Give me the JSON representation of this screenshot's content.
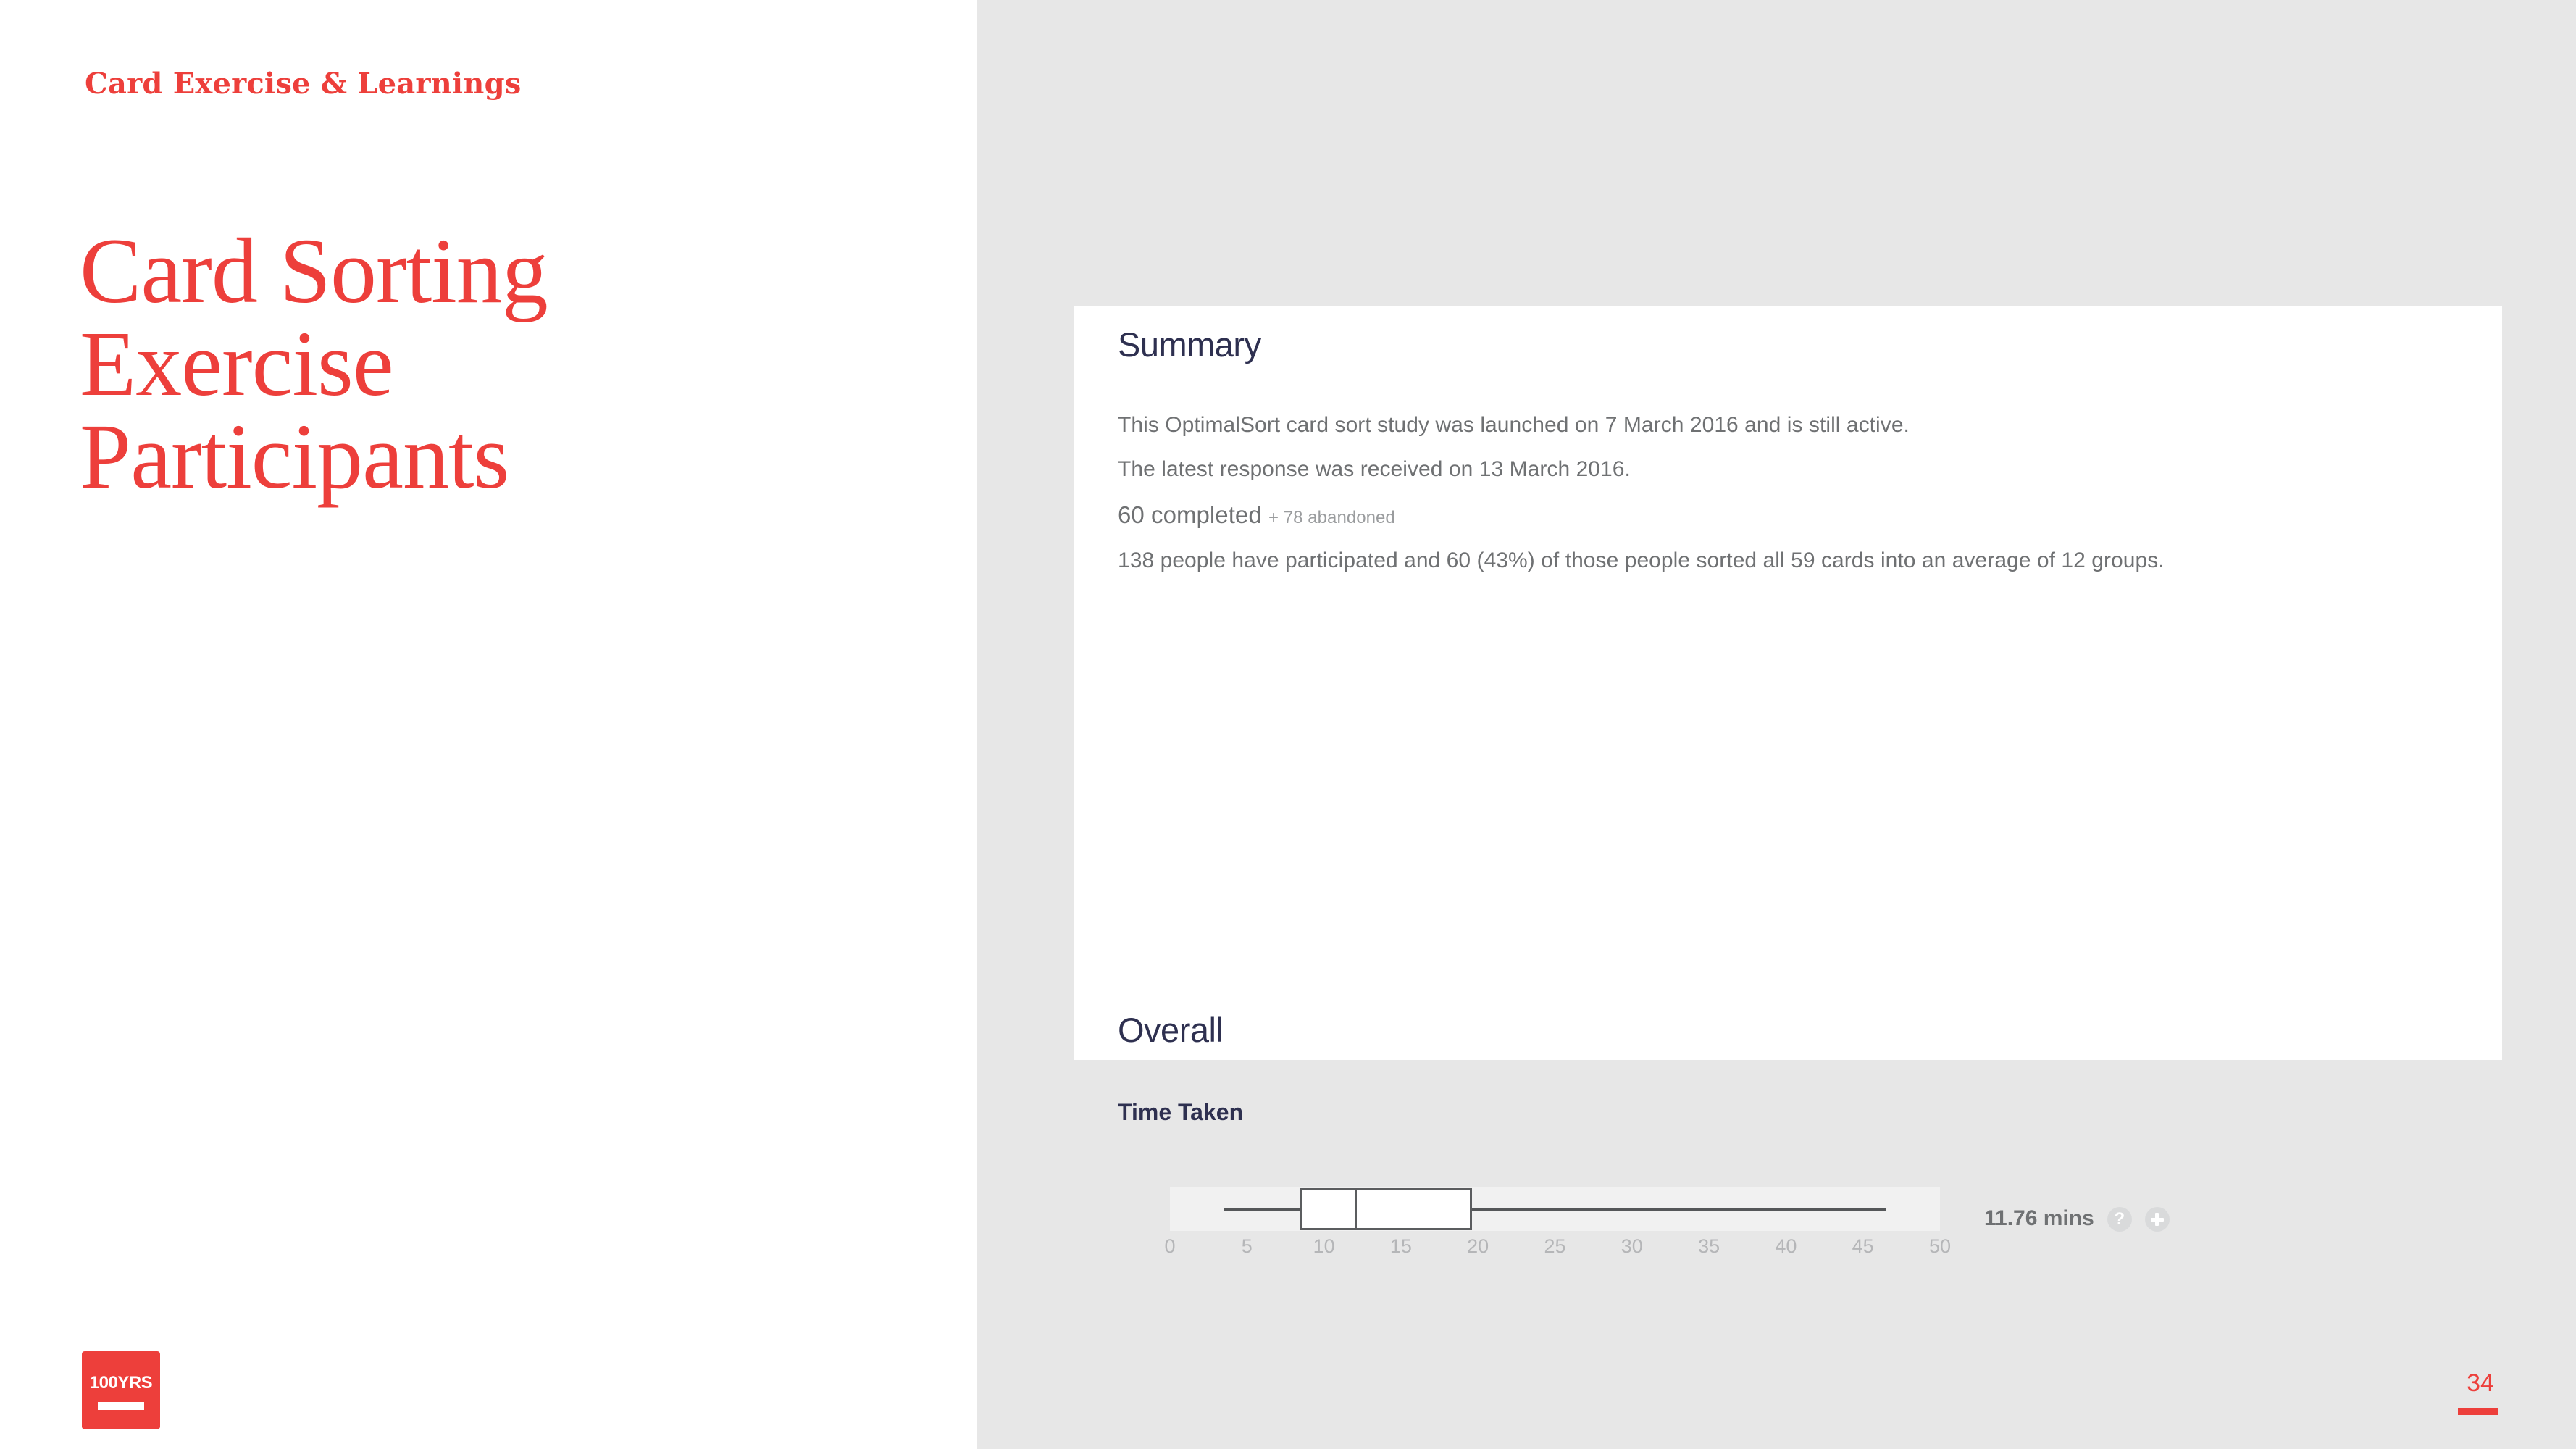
{
  "slide": {
    "eyebrow": "Card Exercise & Learnings",
    "title_lines": [
      "Card Sorting",
      "Exercise",
      "Participants"
    ],
    "page_number": "34",
    "accent_color": "#ed3f3b",
    "background_left": "#ffffff",
    "background_right": "#e7e7e7"
  },
  "logo": {
    "text": "100YRS"
  },
  "card": {
    "summary_heading": "Summary",
    "summary_lines": [
      "This OptimalSort card sort study was launched on 7 March 2016 and is still active.",
      "The latest response was received on 13 March 2016."
    ],
    "completed_label": "60 completed",
    "abandoned_label": "+ 78 abandoned",
    "participation_line": "138 people have participated and 60 (43%) of those people sorted all 59 cards into an average of 12 groups.",
    "overall_heading": "Overall",
    "time_taken_label": "Time Taken",
    "time_taken_value": "11.76 mins",
    "help_icon": "help-circle-icon",
    "add_icon": "plus-circle-icon"
  },
  "chart_data": {
    "type": "box",
    "title": "Time Taken",
    "xlabel": "",
    "ylabel": "",
    "unit": "mins",
    "xlim": [
      0,
      50
    ],
    "ticks": [
      "0",
      "5",
      "10",
      "15",
      "20",
      "25",
      "30",
      "35",
      "40",
      "45",
      "50"
    ],
    "tick_values": [
      0,
      5,
      10,
      15,
      20,
      25,
      30,
      35,
      40,
      45,
      50
    ],
    "grid": false,
    "legend": "none",
    "series": [
      {
        "name": "Time Taken (mins)",
        "whisker_min": 3.5,
        "q1": 8.4,
        "median": 12.0,
        "q3": 19.6,
        "whisker_max": 46.5,
        "mean_label": "11.76 mins",
        "mean": 11.76
      }
    ],
    "colors": {
      "track": "#f1f1f1",
      "box_fill": "#ffffff",
      "box_stroke": "#5b5d5f",
      "whisker": "#555759",
      "tick_label": "#b5b6b8"
    }
  }
}
